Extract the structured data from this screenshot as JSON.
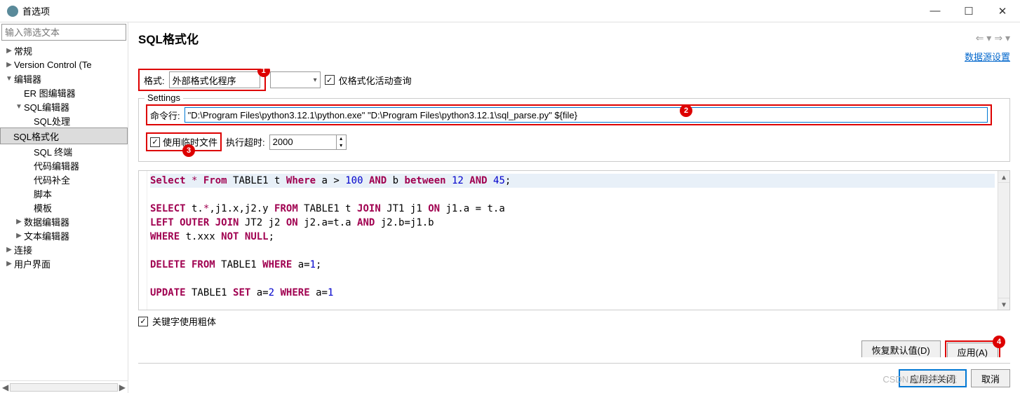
{
  "window": {
    "title": "首选项"
  },
  "filter": {
    "placeholder": "输入筛选文本"
  },
  "tree": {
    "items": [
      {
        "label": "常规",
        "depth": 0,
        "tw": "▶"
      },
      {
        "label": "Version Control (Te",
        "depth": 0,
        "tw": "▶"
      },
      {
        "label": "编辑器",
        "depth": 0,
        "tw": "▼"
      },
      {
        "label": "ER 图编辑器",
        "depth": 1,
        "tw": ""
      },
      {
        "label": "SQL编辑器",
        "depth": 1,
        "tw": "▼"
      },
      {
        "label": "SQL处理",
        "depth": 2,
        "tw": ""
      },
      {
        "label": "SQL格式化",
        "depth": 2,
        "tw": "",
        "sel": true
      },
      {
        "label": "SQL 终端",
        "depth": 2,
        "tw": ""
      },
      {
        "label": "代码编辑器",
        "depth": 2,
        "tw": ""
      },
      {
        "label": "代码补全",
        "depth": 2,
        "tw": ""
      },
      {
        "label": "脚本",
        "depth": 2,
        "tw": ""
      },
      {
        "label": "模板",
        "depth": 2,
        "tw": ""
      },
      {
        "label": "数据编辑器",
        "depth": 1,
        "tw": "▶"
      },
      {
        "label": "文本编辑器",
        "depth": 1,
        "tw": "▶"
      },
      {
        "label": "连接",
        "depth": 0,
        "tw": "▶"
      },
      {
        "label": "用户界面",
        "depth": 0,
        "tw": "▶"
      }
    ]
  },
  "header": {
    "title": "SQL格式化",
    "link": "数据源设置"
  },
  "form": {
    "format_label": "格式:",
    "format_value": "外部格式化程序",
    "only_active_label": "仅格式化活动查询",
    "settings_legend": "Settings",
    "cmd_label": "命令行:",
    "cmd_value": "\"D:\\Program Files\\python3.12.1\\python.exe\" \"D:\\Program Files\\python3.12.1\\sql_parse.py\" ${file}",
    "temp_label": "使用临时文件",
    "timeout_label": "执行超时:",
    "timeout_value": "2000",
    "bold_label": "关键字使用粗体"
  },
  "code": {
    "l1": {
      "p": [
        [
          "kw",
          "Select"
        ],
        [
          "op",
          " "
        ],
        [
          "star",
          "*"
        ],
        [
          "op",
          " "
        ],
        [
          "kw",
          "From"
        ],
        [
          "op",
          " TABLE1 t "
        ],
        [
          "kw",
          "Where"
        ],
        [
          "op",
          " a > "
        ],
        [
          "num",
          "100"
        ],
        [
          "op",
          " "
        ],
        [
          "kw",
          "AND"
        ],
        [
          "op",
          " b "
        ],
        [
          "kw",
          "between"
        ],
        [
          "op",
          " "
        ],
        [
          "num",
          "12"
        ],
        [
          "op",
          " "
        ],
        [
          "kw",
          "AND"
        ],
        [
          "op",
          " "
        ],
        [
          "num",
          "45"
        ],
        [
          "op",
          ";"
        ]
      ]
    },
    "l2": "",
    "l3": {
      "p": [
        [
          "kw",
          "SELECT"
        ],
        [
          "op",
          " t."
        ],
        [
          "star",
          "*"
        ],
        [
          "op",
          ",j1.x,j2.y "
        ],
        [
          "kw",
          "FROM"
        ],
        [
          "op",
          " TABLE1 t "
        ],
        [
          "kw",
          "JOIN"
        ],
        [
          "op",
          " JT1 j1 "
        ],
        [
          "kw",
          "ON"
        ],
        [
          "op",
          " j1.a = t.a"
        ]
      ]
    },
    "l4": {
      "p": [
        [
          "kw",
          "LEFT OUTER JOIN"
        ],
        [
          "op",
          " JT2 j2 "
        ],
        [
          "kw",
          "ON"
        ],
        [
          "op",
          " j2.a=t.a "
        ],
        [
          "kw",
          "AND"
        ],
        [
          "op",
          " j2.b=j1.b"
        ]
      ]
    },
    "l5": {
      "p": [
        [
          "kw",
          "WHERE"
        ],
        [
          "op",
          " t.xxx "
        ],
        [
          "kw",
          "NOT NULL"
        ],
        [
          "op",
          ";"
        ]
      ]
    },
    "l6": "",
    "l7": {
      "p": [
        [
          "kw",
          "DELETE FROM"
        ],
        [
          "op",
          " TABLE1 "
        ],
        [
          "kw",
          "WHERE"
        ],
        [
          "op",
          " a="
        ],
        [
          "num",
          "1"
        ],
        [
          "op",
          ";"
        ]
      ]
    },
    "l8": "",
    "l9": {
      "p": [
        [
          "kw",
          "UPDATE"
        ],
        [
          "op",
          " TABLE1 "
        ],
        [
          "kw",
          "SET"
        ],
        [
          "op",
          " a="
        ],
        [
          "num",
          "2"
        ],
        [
          "op",
          " "
        ],
        [
          "kw",
          "WHERE"
        ],
        [
          "op",
          " a="
        ],
        [
          "num",
          "1"
        ]
      ]
    }
  },
  "buttons": {
    "restore": "恢复默认值(D)",
    "apply": "应用(A)",
    "apply_close": "应用并关闭",
    "cancel": "取消"
  },
  "watermark": "CSDN @数据的流",
  "annotations": {
    "b1": "1",
    "b2": "2",
    "b3": "3",
    "b4": "4"
  }
}
